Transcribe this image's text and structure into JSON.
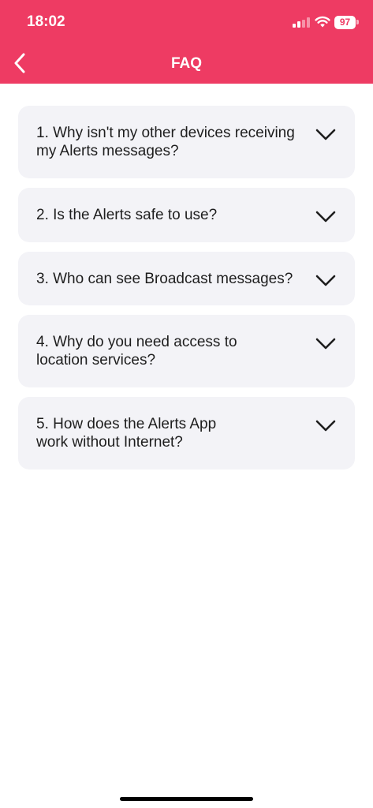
{
  "status_bar": {
    "time": "18:02",
    "battery": "97"
  },
  "header": {
    "title": "FAQ",
    "back_icon": "chevron-left-icon"
  },
  "faq": {
    "items": [
      {
        "question": "1. Why isn't my other devices receiving my Alerts messages?"
      },
      {
        "question": "2. Is the Alerts safe to use?"
      },
      {
        "question": "3. Who can see Broadcast messages?"
      },
      {
        "question": "4. Why do you need access to location services?"
      },
      {
        "question": "5. How does the Alerts App work without Internet?"
      }
    ]
  },
  "colors": {
    "accent": "#ee3b63",
    "card_bg": "#f3f3f7",
    "text": "#1e1e1e"
  }
}
